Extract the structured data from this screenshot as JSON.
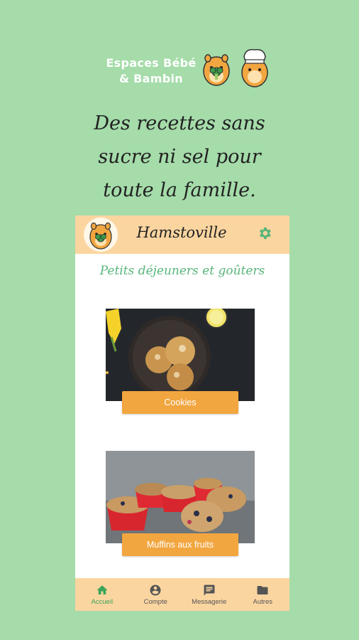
{
  "brand": {
    "line1": "Espaces Bébé",
    "line2": "& Bambin"
  },
  "tagline": {
    "line1": "Des recettes sans",
    "line2": "sucre ni sel pour",
    "line3": "toute la famille."
  },
  "app": {
    "title": "Hamstoville",
    "section_title": "Petits déjeuners et goûters",
    "recipes": [
      {
        "label": "Cookies"
      },
      {
        "label": "Muffins aux fruits"
      }
    ],
    "nav": [
      {
        "label": "Accueil",
        "icon": "home-icon",
        "active": true
      },
      {
        "label": "Compte",
        "icon": "account-icon",
        "active": false
      },
      {
        "label": "Messagerie",
        "icon": "message-icon",
        "active": false
      },
      {
        "label": "Autres",
        "icon": "folder-icon",
        "active": false
      }
    ]
  },
  "colors": {
    "background": "#a5dcaa",
    "header": "#fbd5a0",
    "accent_green": "#58b57a",
    "button_orange": "#f2a640"
  }
}
